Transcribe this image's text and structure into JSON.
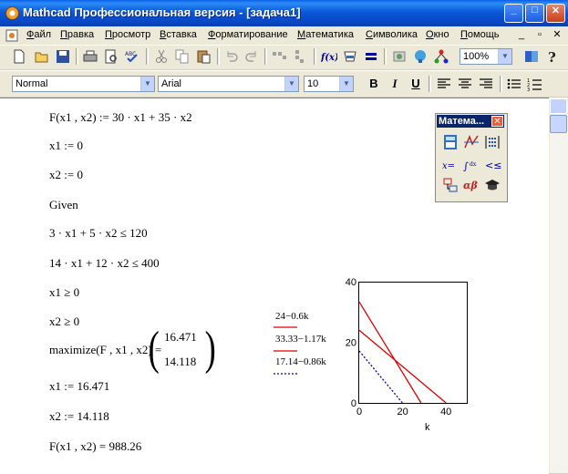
{
  "window": {
    "title": "Mathcad Профессиональная версия - [задача1]",
    "min_label": "_",
    "max_label": "□",
    "close_label": "✕"
  },
  "menu": {
    "items": [
      "Файл",
      "Правка",
      "Просмотр",
      "Вставка",
      "Форматирование",
      "Математика",
      "Символика",
      "Окно",
      "Помощь"
    ],
    "mdi_min": "_",
    "mdi_restore": "▫",
    "mdi_close": "✕"
  },
  "toolbar": {
    "zoom": "100%"
  },
  "format": {
    "style": "Normal",
    "font": "Arial",
    "size": "10",
    "bold": "B",
    "italic": "I",
    "underline": "U"
  },
  "palette": {
    "title": "Матема...",
    "close": "✕"
  },
  "worksheet": {
    "lines": [
      "F(x1 , x2) := 30 · x1 + 35 · x2",
      "x1 := 0",
      "x2 := 0",
      "Given",
      "3 · x1 + 5 · x2 ≤ 120",
      "14 · x1 + 12 · x2 ≤ 400",
      "x1 ≥ 0",
      "x2 ≥ 0",
      "maximize(F , x1 , x2) =",
      "x1 := 16.471",
      "x2 := 14.118",
      "F(x1 , x2) = 988.26"
    ],
    "matrix": [
      "16.471",
      "14.118"
    ]
  },
  "chart_data": {
    "type": "line",
    "xlabel": "k",
    "xlim": [
      0,
      50
    ],
    "ylim": [
      0,
      40
    ],
    "x_ticks": [
      "0",
      "20",
      "40"
    ],
    "y_ticks": [
      "0",
      "20",
      "40"
    ],
    "series": [
      {
        "name": "24−0.6k",
        "color": "#e00000",
        "dash": "solid",
        "x": [
          0,
          40
        ],
        "y": [
          24,
          0
        ]
      },
      {
        "name": "33.33−1.17k",
        "color": "#e00000",
        "dash": "solid",
        "x": [
          0,
          28.5
        ],
        "y": [
          33.33,
          0
        ]
      },
      {
        "name": "17.14−0.86k",
        "color": "#0000c0",
        "dash": "dotted",
        "x": [
          0,
          19.9
        ],
        "y": [
          17.14,
          0
        ]
      }
    ]
  }
}
